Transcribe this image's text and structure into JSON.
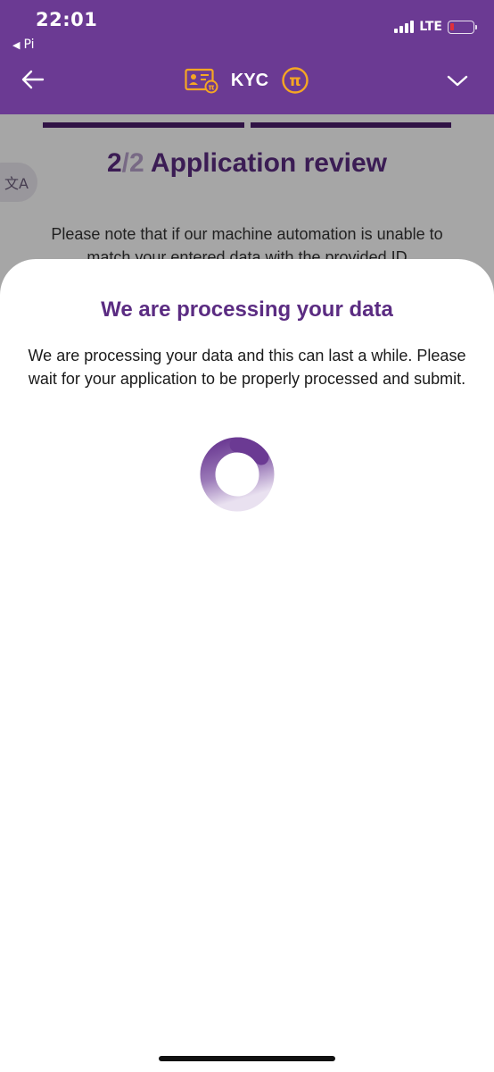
{
  "status_bar": {
    "time": "22:01",
    "back_app": "Pi",
    "network": "LTE"
  },
  "nav": {
    "title": "KYC",
    "back_icon": "arrow-left-icon",
    "menu_icon": "chevron-down-icon",
    "id_card_icon": "id-card-icon",
    "pi_icon": "pi-coin-icon"
  },
  "page": {
    "step_current": "2",
    "step_sep": "/",
    "step_total": "2",
    "step_title": " Application review",
    "translate_icon": "translate-icon",
    "note": "Please note that if our machine automation is unable to match your entered data with the provided ID"
  },
  "sheet": {
    "title": "We are processing your data",
    "message": "We are processing your data and this can last a while. Please wait for your application to be properly processed and submit."
  },
  "colors": {
    "brand": "#6b3a93",
    "title": "#5b2c82",
    "pi_orange": "#f5a623"
  }
}
